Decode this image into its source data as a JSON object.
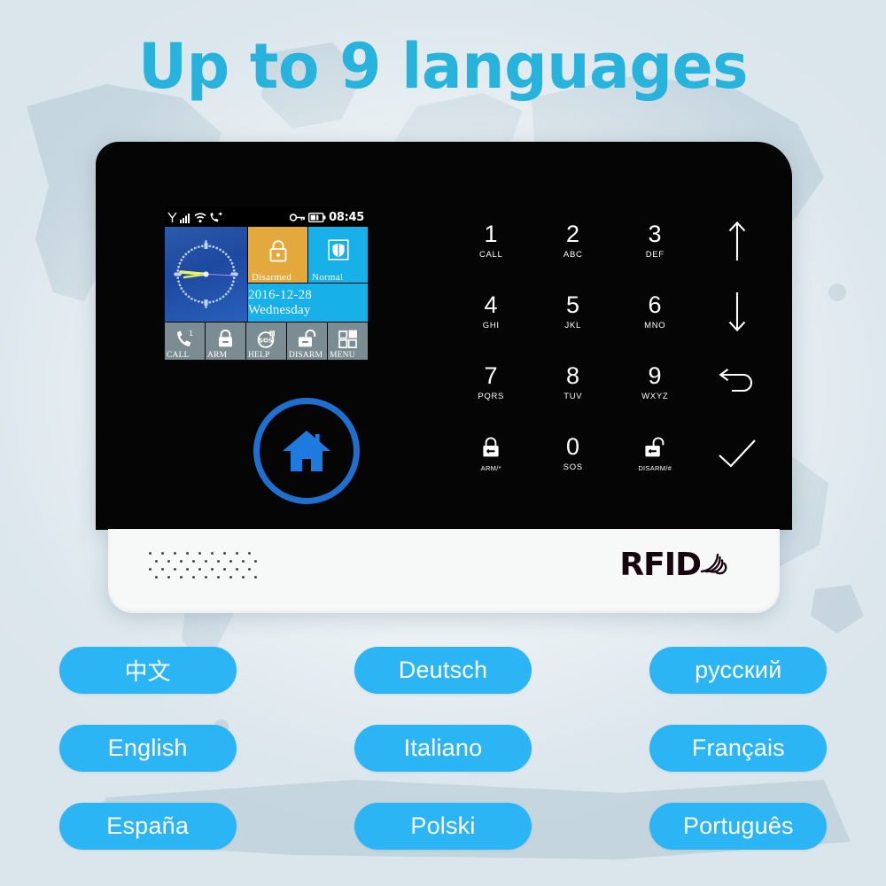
{
  "title": "Up to 9 languages",
  "theme": {
    "accent": "#2cb5f5",
    "title_color": "#28b3dd",
    "background": "#dde7ec",
    "panel_black": "#050505",
    "panel_white": "#f7f8f8",
    "tile_orange": "#e3a93c",
    "tile_cyan": "#17b0e8",
    "tile_blue": "#1e49a1",
    "lcd_button_gray": "#7b8c93",
    "home_ring": "#1f6fd0"
  },
  "device": {
    "lcd": {
      "status_bar": {
        "left_icons": [
          "antenna-icon",
          "signal-bars-icon",
          "wifi-icon",
          "call-forward-icon"
        ],
        "right_icons": [
          "key-icon",
          "battery-icon"
        ],
        "time": "08:45"
      },
      "tiles": {
        "clock": {
          "icon": "analog-clock-icon"
        },
        "arm_state": {
          "icon": "lock-icon",
          "label": "Disarmed"
        },
        "system_state": {
          "icon": "shield-icon",
          "label": "Normal"
        },
        "date": "2016-12-28 Wednesday"
      },
      "buttons": [
        {
          "icon": "phone-icon",
          "label": "CALL"
        },
        {
          "icon": "lock-icon",
          "label": "ARM"
        },
        {
          "icon": "sos-icon",
          "label": "HELP"
        },
        {
          "icon": "unlock-icon",
          "label": "DISARM"
        },
        {
          "icon": "grid-icon",
          "label": "MENU"
        }
      ]
    },
    "home_button": {
      "icon": "home-icon"
    },
    "keypad": [
      {
        "digit": "1",
        "sub": "CALL",
        "icon": ""
      },
      {
        "digit": "2",
        "sub": "ABC",
        "icon": ""
      },
      {
        "digit": "3",
        "sub": "DEF",
        "icon": ""
      },
      {
        "digit": "",
        "sub": "",
        "icon": "arrow-up-icon"
      },
      {
        "digit": "4",
        "sub": "GHI",
        "icon": ""
      },
      {
        "digit": "5",
        "sub": "JKL",
        "icon": ""
      },
      {
        "digit": "6",
        "sub": "MNO",
        "icon": ""
      },
      {
        "digit": "",
        "sub": "",
        "icon": "arrow-down-icon"
      },
      {
        "digit": "7",
        "sub": "PQRS",
        "icon": ""
      },
      {
        "digit": "8",
        "sub": "TUV",
        "icon": ""
      },
      {
        "digit": "9",
        "sub": "WXYZ",
        "icon": ""
      },
      {
        "digit": "",
        "sub": "",
        "icon": "back-arrow-icon"
      },
      {
        "digit": "",
        "sub": "ARM/*",
        "icon": "lock-icon"
      },
      {
        "digit": "0",
        "sub": "SOS",
        "icon": ""
      },
      {
        "digit": "",
        "sub": "DISARM/#",
        "icon": "unlock-icon"
      },
      {
        "digit": "",
        "sub": "",
        "icon": "check-icon"
      }
    ],
    "base": {
      "speaker": "speaker-grille",
      "rfid_label": "RFID",
      "rfid_icon": "rfid-waves-icon"
    }
  },
  "languages": [
    "中文",
    "Deutsch",
    "русский",
    "English",
    "Italiano",
    "Français",
    "España",
    "Polski",
    "Português"
  ]
}
